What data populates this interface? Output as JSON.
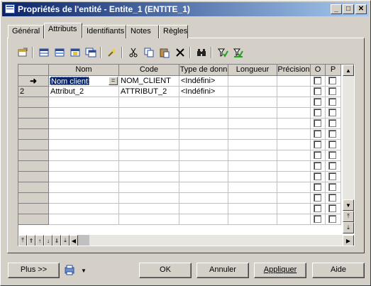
{
  "window": {
    "title": "Propriétés de l'entité - Entite_1 (ENTITE_1)",
    "minimize": "_",
    "maximize": "□",
    "close": "✕"
  },
  "tabs": [
    {
      "label": "Général",
      "active": false
    },
    {
      "label": "Attributs",
      "active": true
    },
    {
      "label": "Identifiants",
      "active": false
    },
    {
      "label": "Notes",
      "active": false
    },
    {
      "label": "Règles",
      "active": false
    }
  ],
  "toolbar": {
    "icons": [
      "properties-icon",
      "add-row-icon",
      "insert-row-icon",
      "add-attributes-icon",
      "reuse-attributes-icon",
      "new-domain-icon",
      "cut-icon",
      "copy-icon",
      "paste-icon",
      "delete-icon",
      "find-icon",
      "filter-icon",
      "clear-filter-icon"
    ]
  },
  "grid": {
    "columns": [
      "Nom",
      "Code",
      "Type de donn",
      "Longueur",
      "Précision",
      "O",
      "P"
    ],
    "rows": [
      {
        "marker": "➜",
        "nom": "Nom client",
        "code": "NOM_CLIENT",
        "type": "<Indéfini>",
        "longueur": "",
        "precision": "",
        "o": false,
        "p": false,
        "editing": true
      },
      {
        "marker": "2",
        "nom": "Attribut_2",
        "code": "ATTRIBUT_2",
        "type": "<Indéfini>",
        "longueur": "",
        "precision": "",
        "o": false,
        "p": false,
        "editing": false
      }
    ],
    "empty_rows": 12,
    "edit_button": "="
  },
  "buttons": {
    "plus": "Plus >>",
    "ok": "OK",
    "annuler": "Annuler",
    "appliquer": "Appliquer",
    "aide": "Aide"
  },
  "colors": {
    "face": "#d4d0c8",
    "title_start": "#0a246a",
    "title_end": "#a6caf0",
    "selection": "#0a246a"
  }
}
